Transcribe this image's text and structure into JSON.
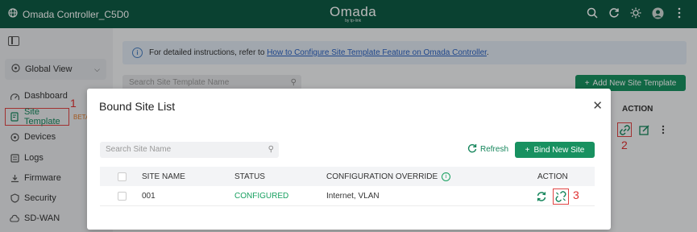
{
  "header": {
    "controller_name": "Omada Controller_C5D0",
    "logo_text": "Omada",
    "logo_sub": "by tp-link"
  },
  "sidebar": {
    "site_selector": "Global View",
    "items": [
      {
        "label": "Dashboard",
        "icon": "dashboard-icon"
      },
      {
        "label": "Site Template",
        "icon": "site-template-icon"
      },
      {
        "label": "Devices",
        "icon": "devices-icon"
      },
      {
        "label": "Logs",
        "icon": "logs-icon"
      },
      {
        "label": "Firmware",
        "icon": "firmware-icon"
      },
      {
        "label": "Security",
        "icon": "security-icon"
      },
      {
        "label": "SD-WAN",
        "icon": "sdwan-icon"
      }
    ],
    "beta_badge": "BETA"
  },
  "main": {
    "info_text": "For detailed instructions, refer to",
    "info_link": "How to Configure Site Template Feature on Omada Controller",
    "info_suffix": ".",
    "search_placeholder": "Search Site Template Name",
    "add_button": "Add New Site Template",
    "action_header": "ACTION"
  },
  "modal": {
    "title": "Bound Site List",
    "search_placeholder": "Search Site Name",
    "refresh_label": "Refresh",
    "bind_button": "Bind New Site",
    "columns": {
      "site_name": "SITE NAME",
      "status": "STATUS",
      "override": "CONFIGURATION OVERRIDE",
      "action": "ACTION"
    },
    "rows": [
      {
        "site_name": "001",
        "status": "CONFIGURED",
        "override": "Internet, VLAN"
      }
    ]
  },
  "annotations": {
    "step1": "1",
    "step2": "2",
    "step3": "3"
  },
  "colors": {
    "brand_green": "#0f5a44",
    "button_green": "#189160",
    "highlight_red": "#e04545"
  }
}
